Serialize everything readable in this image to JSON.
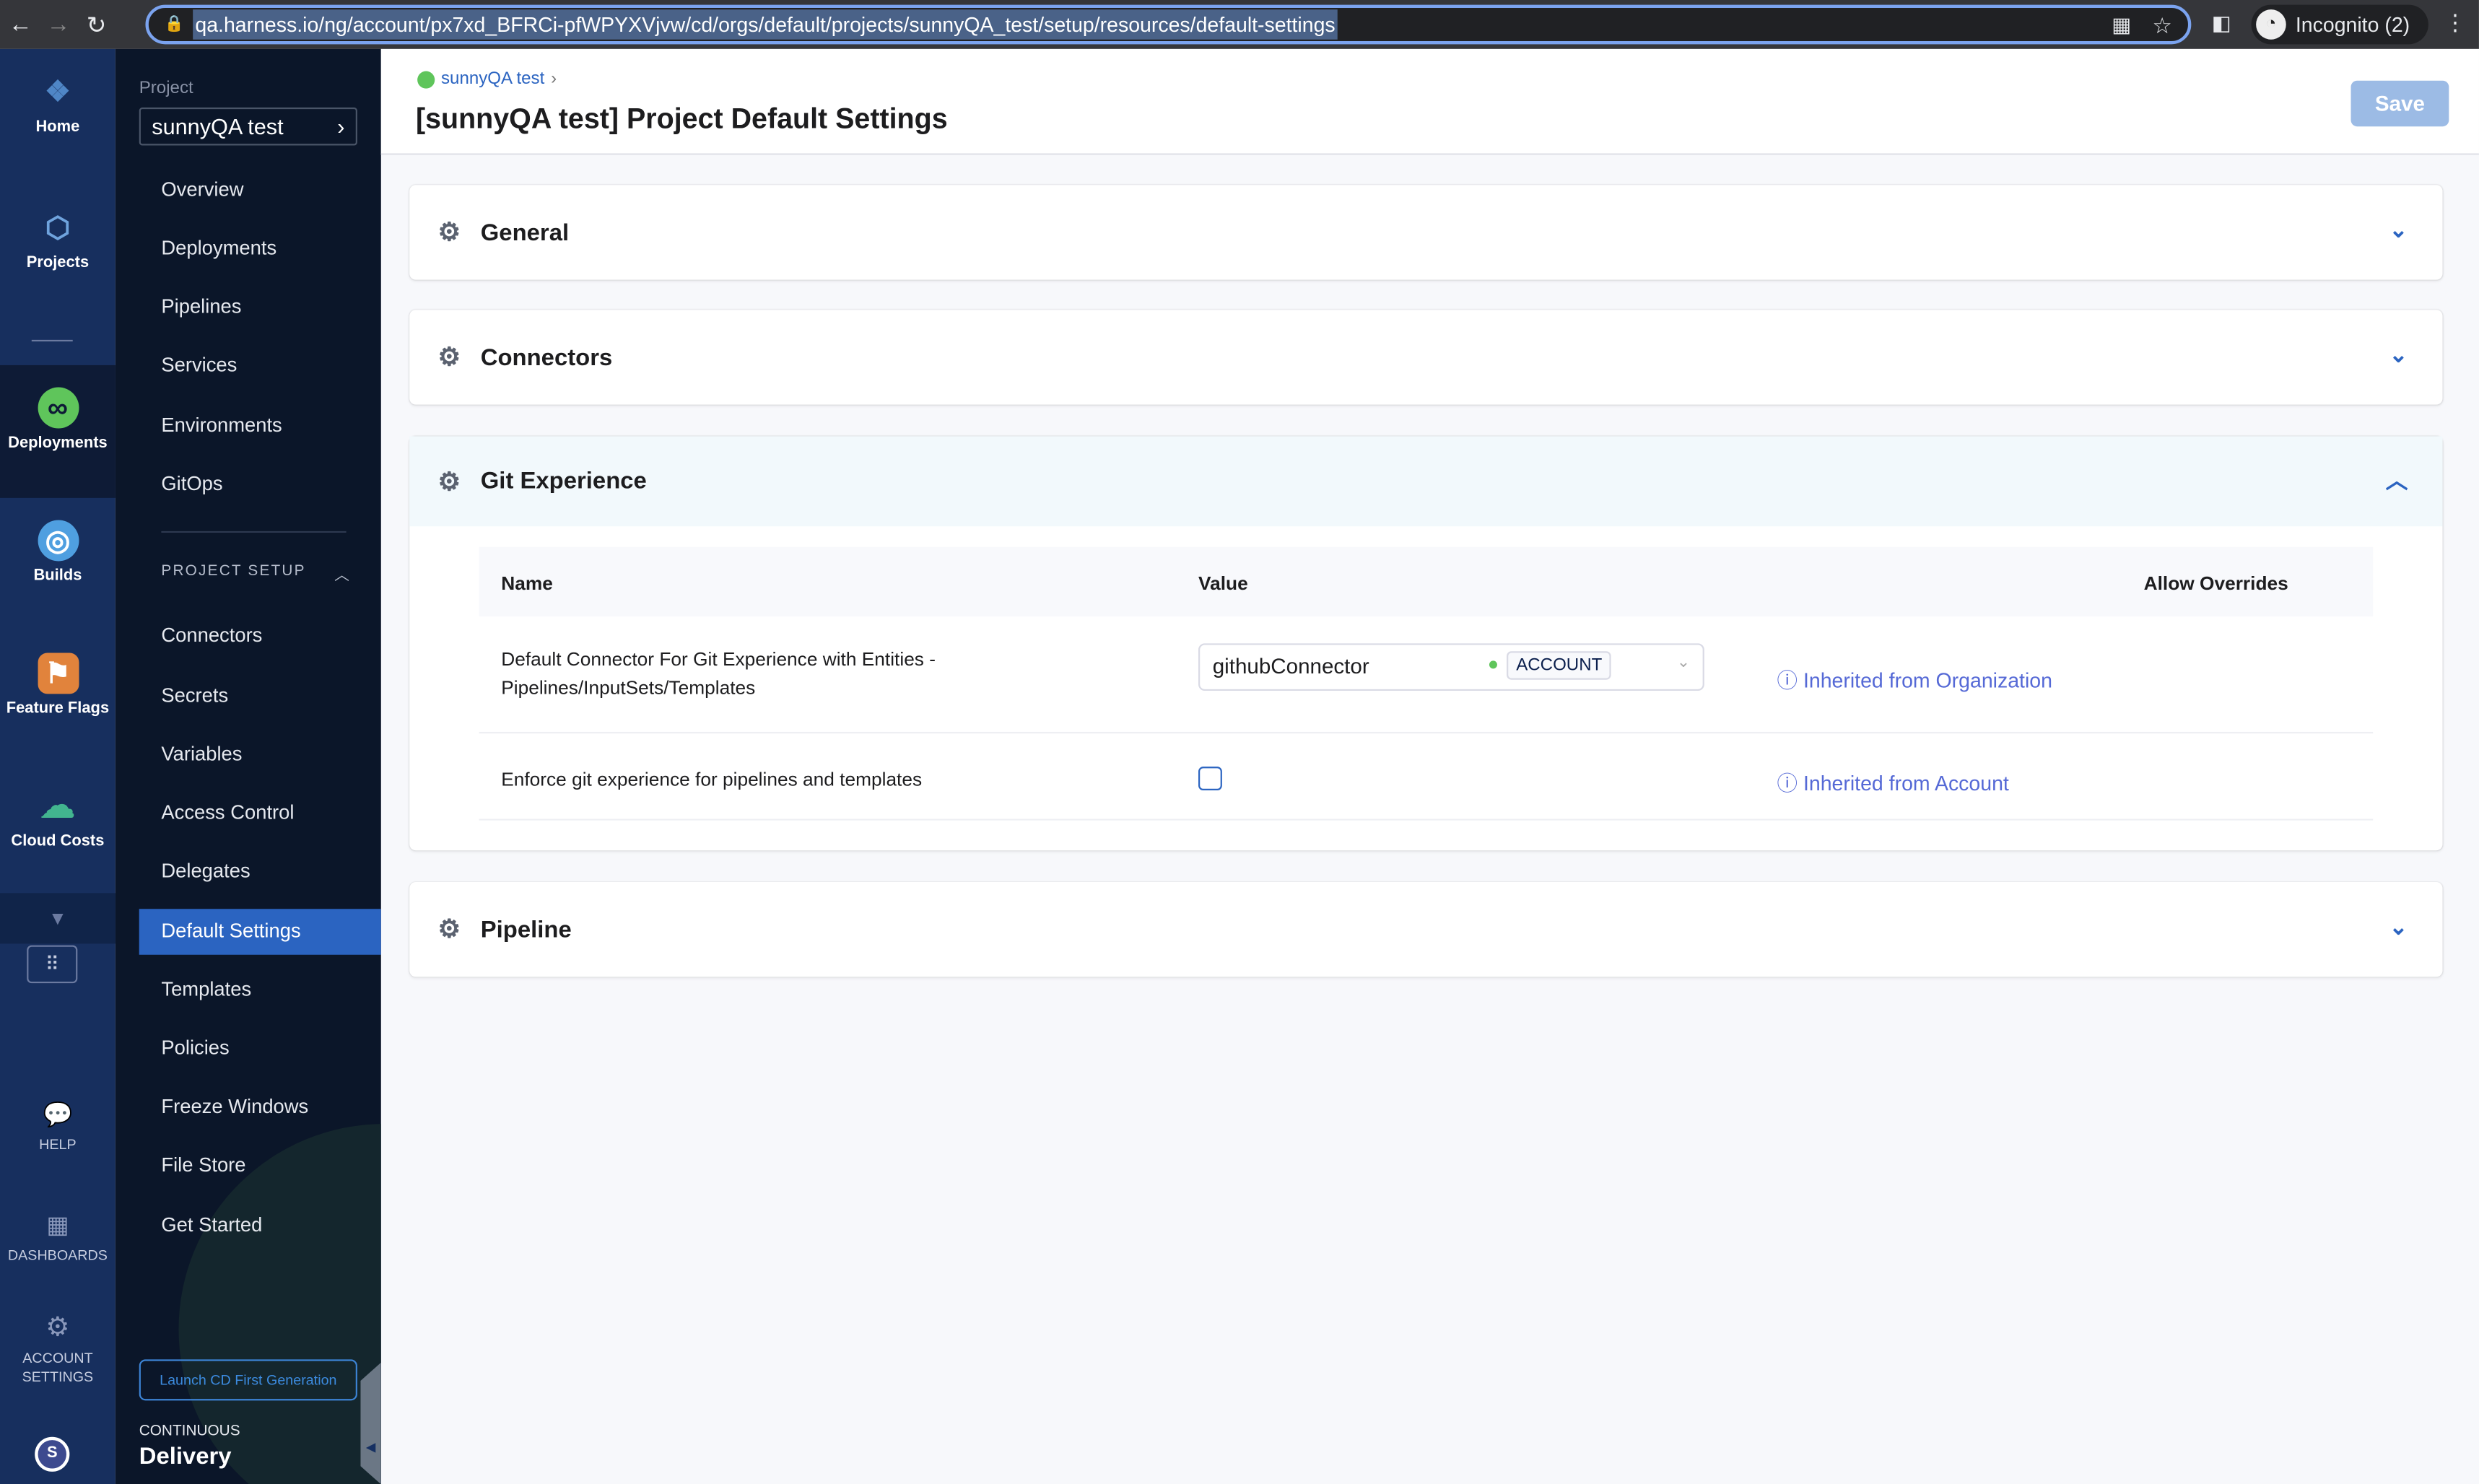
{
  "browser": {
    "url": "qa.harness.io/ng/account/px7xd_BFRCi-pfWPYXVjvw/cd/orgs/default/projects/sunnyQA_test/setup/resources/default-settings",
    "profile": "Incognito (2)"
  },
  "rail": {
    "items": [
      {
        "label": "Home",
        "icon": "harness-logo-icon"
      },
      {
        "label": "Projects",
        "icon": "cube-icon"
      },
      {
        "label": "Deployments",
        "icon": "deployments-icon"
      },
      {
        "label": "Builds",
        "icon": "builds-icon"
      },
      {
        "label": "Feature Flags",
        "icon": "flag-icon"
      },
      {
        "label": "Cloud Costs",
        "icon": "cloud-dollar-icon"
      },
      {
        "label": "HELP",
        "icon": "help-icon"
      },
      {
        "label": "DASHBOARDS",
        "icon": "dashboards-icon"
      },
      {
        "label": "ACCOUNT SETTINGS",
        "icon": "gear-icon"
      }
    ],
    "avatar": "S"
  },
  "sidebar": {
    "project_label": "Project",
    "project": "sunnyQA test",
    "items": [
      "Overview",
      "Deployments",
      "Pipelines",
      "Services",
      "Environments",
      "GitOps"
    ],
    "section": "PROJECT SETUP",
    "setup_items": [
      "Connectors",
      "Secrets",
      "Variables",
      "Access Control",
      "Delegates",
      "Default Settings",
      "Templates",
      "Policies",
      "Freeze Windows",
      "File Store",
      "Get Started"
    ],
    "selected": "Default Settings",
    "launch": "Launch CD First Generation",
    "module_top": "CONTINUOUS",
    "module": "Delivery"
  },
  "header": {
    "breadcrumb": "sunnyQA test",
    "title": "[sunnyQA test] Project Default Settings",
    "save": "Save"
  },
  "sections": [
    {
      "title": "General",
      "expanded": false
    },
    {
      "title": "Connectors",
      "expanded": false
    },
    {
      "title": "Git Experience",
      "expanded": true
    },
    {
      "title": "Pipeline",
      "expanded": false
    }
  ],
  "git": {
    "columns": [
      "Name",
      "Value",
      "Allow Overrides"
    ],
    "rows": [
      {
        "name_line1": "Default Connector For Git Experience with Entities -",
        "name_line2": "Pipelines/InputSets/Templates",
        "value": "githubConnector",
        "scope": "ACCOUNT",
        "inherited": "Inherited from Organization"
      },
      {
        "name": "Enforce git experience for pipelines and templates",
        "checked": false,
        "inherited": "Inherited from Account"
      }
    ]
  }
}
